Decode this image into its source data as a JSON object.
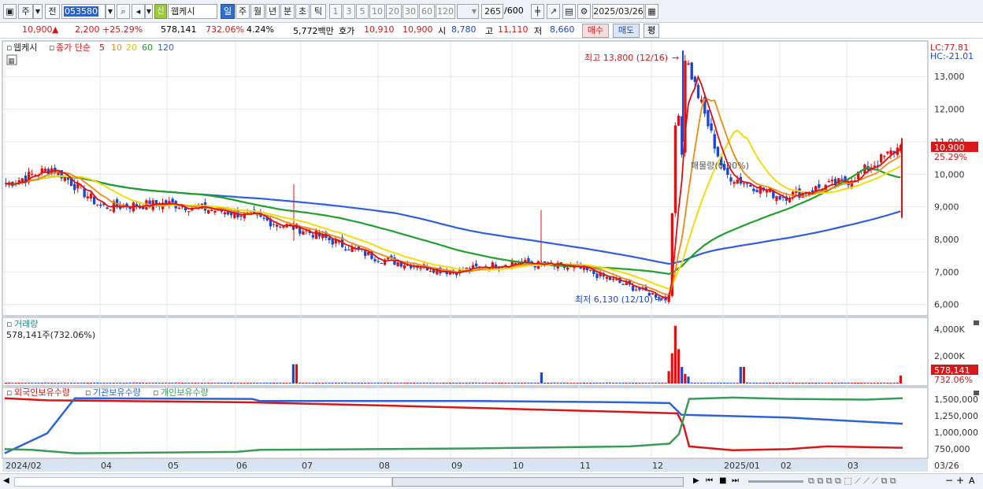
{
  "toolbar": {
    "market_label": "주",
    "all_label": "전",
    "stock_code": "053580",
    "new_tag": "신",
    "stock_name": "웹케시",
    "periods": [
      "일",
      "주",
      "월",
      "년",
      "분",
      "초",
      "틱"
    ],
    "active_period": "일",
    "intervals": [
      "1",
      "3",
      "5",
      "10",
      "20",
      "30",
      "60",
      "120"
    ],
    "bar_count": "265",
    "bar_total": "/600",
    "date": "2025/03/26"
  },
  "quote": {
    "price": "10,900",
    "change": "2,200",
    "change_pct": "+25.29%",
    "volume": "578,141",
    "volume_ratio": "732.06%",
    "turnover_pct": "4.24%",
    "amount": "5,772백만",
    "quote_label": "호가",
    "ask": "10,910",
    "bid": "10,900",
    "open_label": "시",
    "open": "8,780",
    "high_label": "고",
    "high": "11,110",
    "low_label": "저",
    "low": "8,660",
    "buy_label": "매수",
    "sell_label": "매도",
    "avg_label": "평"
  },
  "price_panel": {
    "legend_name": "웹케시",
    "legend_ma_label": "종가 단순",
    "ma_periods": [
      "5",
      "10",
      "20",
      "60",
      "120"
    ],
    "lc": "LC:77.81",
    "hc": "HC:-21.01",
    "high_annotation": "최고 13,800 (12/16)",
    "low_annotation": "최저 6,130 (12/10)",
    "overlay_text": "매물량(0.00%)",
    "current_price_tag": "10,900",
    "current_pct_tag": "25.29%",
    "y_ticks": [
      "13,000",
      "12,000",
      "11,000",
      "10,000",
      "9,000",
      "8,000",
      "7,000",
      "6,000"
    ]
  },
  "volume_panel": {
    "title": "거래량",
    "current": "578,141주(732.06%)",
    "y_ticks": [
      "4,000K",
      "2,000K"
    ],
    "tag_value": "578,141",
    "tag_pct": "732.06%"
  },
  "holding_panel": {
    "legend": [
      "외국인보유수량",
      "기관보유수량",
      "개인보유수량"
    ],
    "y_ticks": [
      "1,500,000",
      "1,250,000",
      "1,000,000",
      "750,000"
    ]
  },
  "x_axis": {
    "labels": [
      "2024/02",
      "04",
      "05",
      "06",
      "07",
      "08",
      "09",
      "10",
      "11",
      "12",
      "2025/01",
      "02",
      "03"
    ],
    "right_label": "03/26"
  },
  "colors": {
    "ma5": "#e01010",
    "ma10": "#f08a10",
    "ma20": "#f2dc10",
    "ma60": "#22a02a",
    "ma120": "#2f5fe0",
    "up": "#e01010",
    "down": "#1a46d8",
    "foreign": "#d81818",
    "institution": "#2e63d6",
    "individual": "#3c9a58"
  },
  "chart_data": [
    {
      "type": "candlestick",
      "title": "웹케시",
      "x_range": [
        "2024/02",
        "2025/03/26"
      ],
      "ylim": [
        5800,
        13900
      ],
      "key_points": [
        {
          "x": "2024/02",
          "close": 9700
        },
        {
          "x": "2024/03",
          "close": 10200
        },
        {
          "x": "2024/04",
          "close": 9000
        },
        {
          "x": "2024/05",
          "close": 9100
        },
        {
          "x": "2024/06",
          "close": 8800
        },
        {
          "x": "2024/07",
          "close": 8300
        },
        {
          "x": "2024/08",
          "close": 7400
        },
        {
          "x": "2024/09",
          "close": 7000
        },
        {
          "x": "2024/10",
          "close": 7300
        },
        {
          "x": "2024/11",
          "close": 7100
        },
        {
          "x": "2024/12/10",
          "low": 6130
        },
        {
          "x": "2024/12/16",
          "high": 13800
        },
        {
          "x": "2025/01",
          "close": 10000
        },
        {
          "x": "2025/02",
          "close": 9300
        },
        {
          "x": "2025/03",
          "close": 9800
        },
        {
          "x": "2025/03/26",
          "open": 8780,
          "high": 11110,
          "low": 8660,
          "close": 10900
        }
      ],
      "moving_averages": {
        "ma60_end": 9700,
        "ma120_end": 8600
      }
    },
    {
      "type": "bar",
      "title": "거래량",
      "unit": "주",
      "latest": 578141,
      "peak_region": "2024/12",
      "peak_value_k": 4200
    },
    {
      "type": "line",
      "series": [
        {
          "name": "외국인보유수량",
          "start": 1500000,
          "end": 760000
        },
        {
          "name": "기관보유수량",
          "start": 650000,
          "end": 1120000
        },
        {
          "name": "개인보유수량",
          "start": 750000,
          "end": 1480000
        }
      ],
      "ylim": [
        650000,
        1600000
      ]
    }
  ]
}
